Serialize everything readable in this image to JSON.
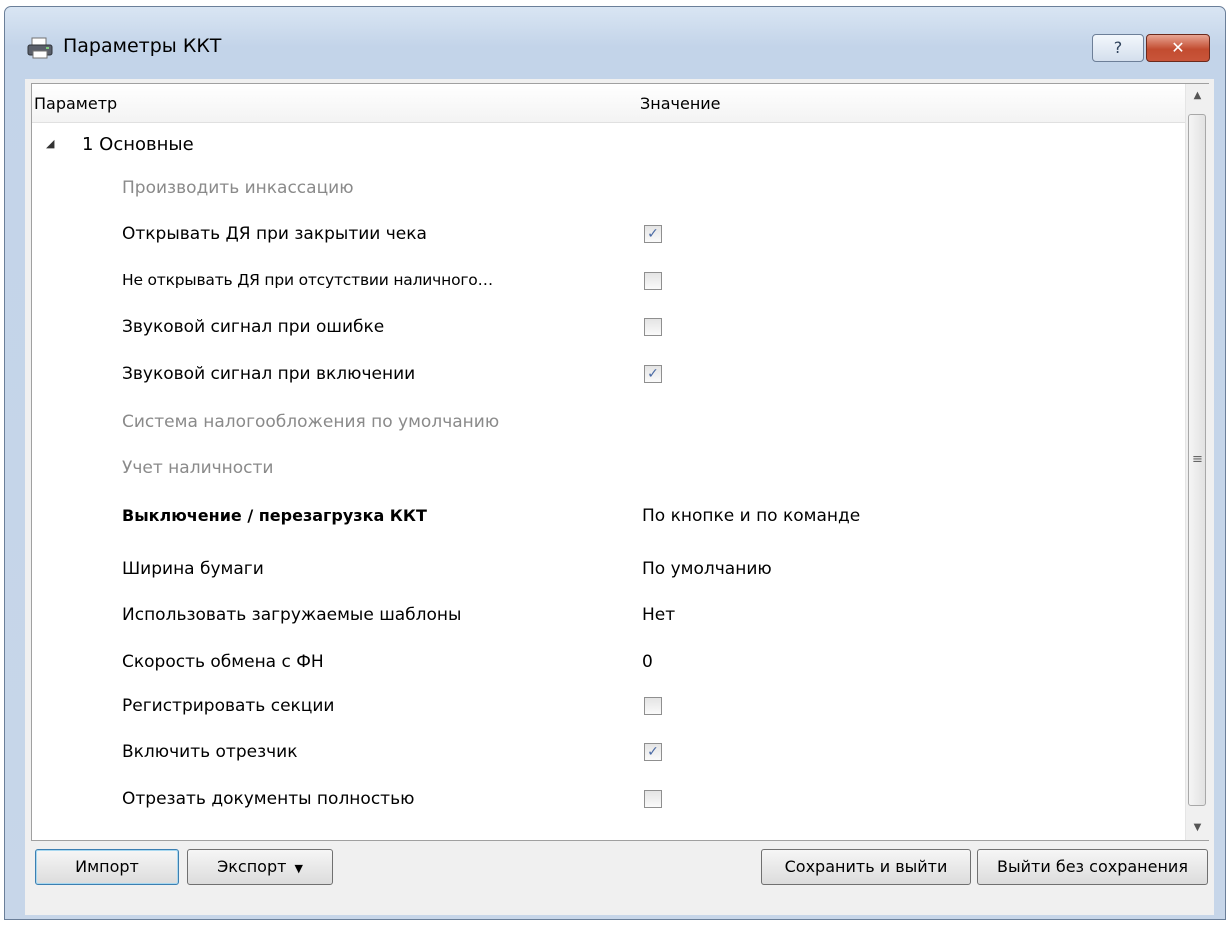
{
  "window": {
    "title": "Параметры ККТ",
    "help_label": "?",
    "close_label": "✕"
  },
  "grid": {
    "columns": [
      "Параметр",
      "Значение"
    ],
    "group": {
      "label": "1 Основные",
      "expanded": true
    },
    "rows": [
      {
        "name": "Производить инкассацию",
        "style": "disabled",
        "value": ""
      },
      {
        "name": "Открывать ДЯ при закрытии чека",
        "style": "normal",
        "checkbox": true,
        "checked": true
      },
      {
        "name": "Не открывать ДЯ при отсутствии наличного…",
        "style": "condensed",
        "checkbox": true,
        "checked": false
      },
      {
        "name": "Звуковой сигнал при ошибке",
        "style": "normal",
        "checkbox": true,
        "checked": false
      },
      {
        "name": "Звуковой сигнал при включении",
        "style": "normal",
        "checkbox": true,
        "checked": true
      },
      {
        "name": "Система налогообложения по умолчанию",
        "style": "disabled",
        "value": ""
      },
      {
        "name": "Учет наличности",
        "style": "disabled",
        "value": ""
      },
      {
        "name": "Выключение / перезагрузка ККТ",
        "style": "bold",
        "value": "По кнопке и по команде"
      },
      {
        "name": "Ширина бумаги",
        "style": "normal",
        "value": "По умолчанию"
      },
      {
        "name": "Использовать загружаемые шаблоны",
        "style": "normal",
        "value": "Нет"
      },
      {
        "name": "Скорость обмена с ФН",
        "style": "normal",
        "value": "0"
      },
      {
        "name": "Регистрировать секции",
        "style": "normal",
        "checkbox": true,
        "checked": false
      },
      {
        "name": "Включить отрезчик",
        "style": "normal",
        "checkbox": true,
        "checked": true
      },
      {
        "name": "Отрезать документы полностью",
        "style": "normal",
        "checkbox": true,
        "checked": false
      }
    ]
  },
  "buttons": {
    "import": "Импорт",
    "export": "Экспорт",
    "save_exit": "Сохранить и выйти",
    "exit_no_save": "Выйти без сохранения"
  },
  "icons": {
    "app": "printer-icon",
    "expand": "triangle-expanded-icon",
    "scroll_up": "arrow-up-icon",
    "scroll_down": "arrow-down-icon",
    "dropdown": "dropdown-caret-icon"
  },
  "colors": {
    "title_bar": "#c3d4e9",
    "close_button": "#c24c30",
    "disabled_text": "#8a8a8a",
    "checkmark": "#4a6aa5"
  }
}
